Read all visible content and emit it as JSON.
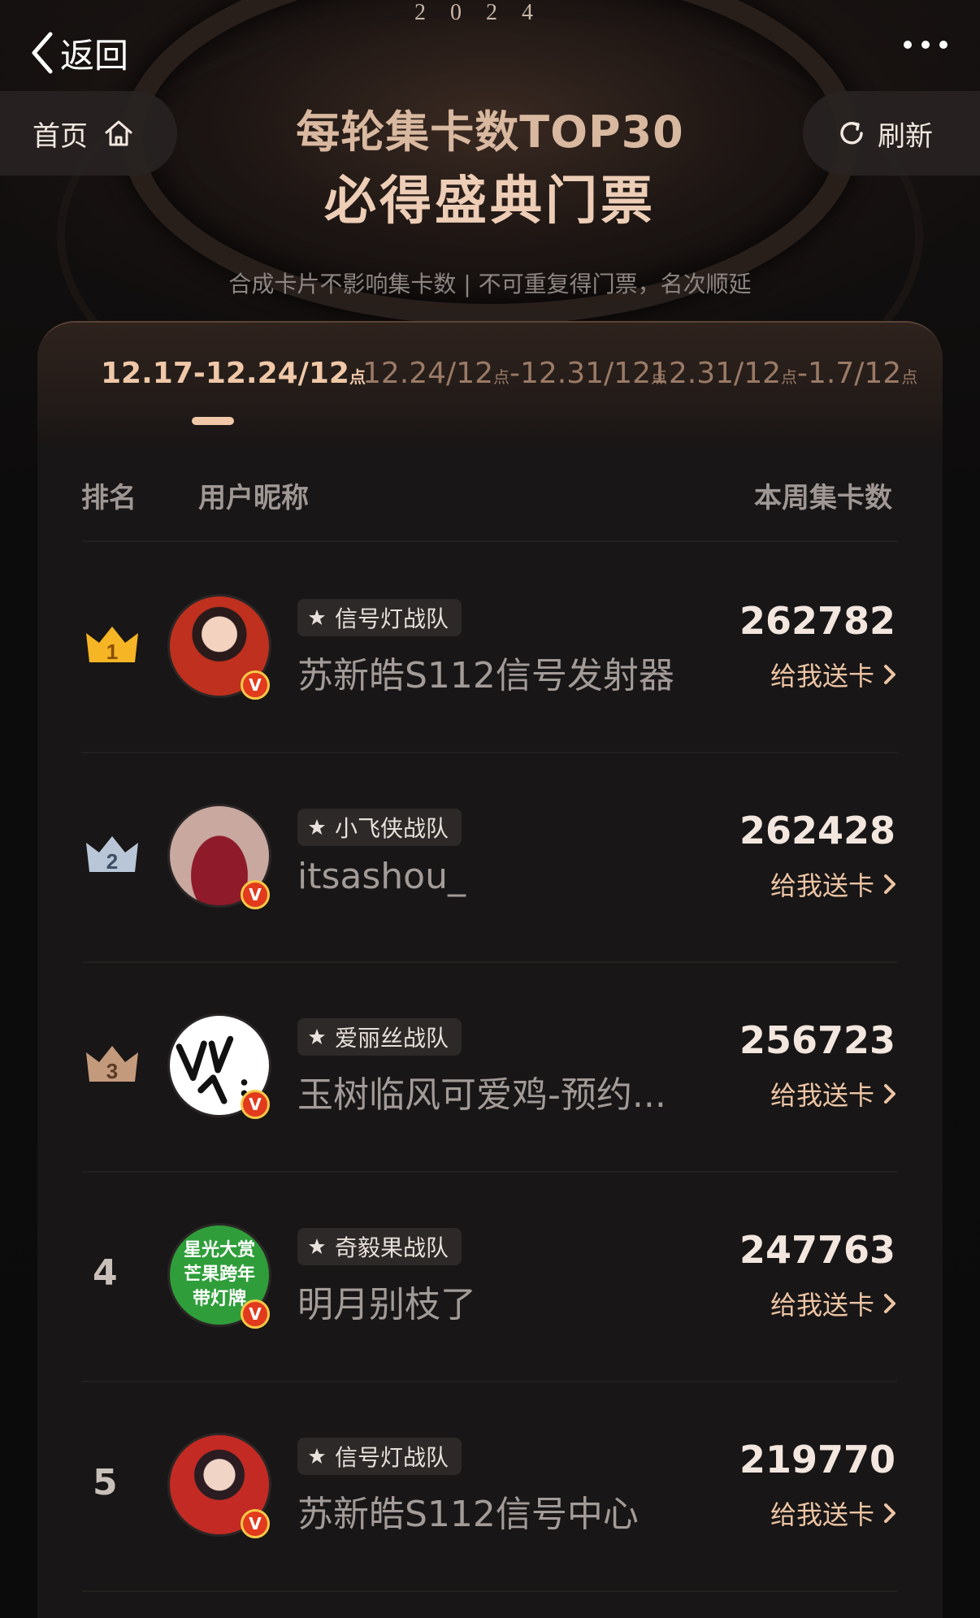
{
  "nav": {
    "back_label": "返回",
    "home_label": "首页",
    "refresh_label": "刷新"
  },
  "hero": {
    "year": "2024",
    "title_line1": "每轮集卡数TOP30",
    "title_line2": "必得盛典门票",
    "note": "合成卡片不影响集卡数 | 不可重复得门票，名次顺延"
  },
  "tabs": [
    {
      "main": "12.17-12.24/12",
      "suffix": "点",
      "active": true
    },
    {
      "main": "12.24/12",
      "suffix": "点",
      "main2": "-12.31/12",
      "suffix2": "点",
      "active": false
    },
    {
      "main": "12.31/12",
      "suffix": "点",
      "main2": "-1.7/12",
      "suffix2": "点",
      "active": false
    }
  ],
  "table": {
    "col_rank": "排名",
    "col_user": "用户昵称",
    "col_count": "本周集卡数",
    "send_label": "给我送卡"
  },
  "rows": [
    {
      "rank": "1",
      "team": "信号灯战队",
      "nickname": "苏新皓S112信号发射器",
      "count": "262782"
    },
    {
      "rank": "2",
      "team": "小飞侠战队",
      "nickname": "itsashou_",
      "count": "262428"
    },
    {
      "rank": "3",
      "team": "爱丽丝战队",
      "nickname": "玉树临风可爱鸡-预约...",
      "count": "256723"
    },
    {
      "rank": "4",
      "team": "奇毅果战队",
      "nickname": "明月别枝了",
      "count": "247763",
      "avatar_text": [
        "星光大赏",
        "芒果跨年",
        "带灯牌"
      ]
    },
    {
      "rank": "5",
      "team": "信号灯战队",
      "nickname": "苏新皓S112信号中心",
      "count": "219770"
    }
  ],
  "colors": {
    "accent": "#ecc4a4",
    "crown_gold": "#f5b524",
    "crown_silver": "#b8c6d8",
    "crown_bronze": "#c49a7c",
    "verified": "#e23a1d"
  }
}
